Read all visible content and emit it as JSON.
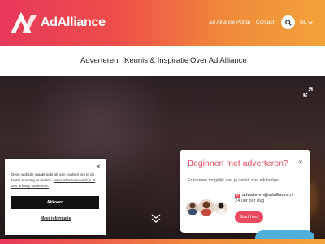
{
  "header": {
    "logo_text": "AdAlliance",
    "links": [
      "Ad Alliance Portal",
      "Contact"
    ],
    "language": "NL"
  },
  "nav": {
    "items": [
      "Adverteren",
      "Kennis & Inspiratie",
      "Over Ad Alliance"
    ]
  },
  "cookie_banner": {
    "text_intro": "Deze website maakt gebruik van cookies om je de beste ervaring te bieden.",
    "link_text": "Meer informatie vind je in ons privacy statement.",
    "accept_label": "Akkoord",
    "more_info_label": "Meer informatie"
  },
  "chat_widget": {
    "title": "Beginnen met adverteren?",
    "subtitle": "Er is meer mogelijk dan je denkt, met elk budget.",
    "email": "adverteren@adalliance.nl",
    "hours": "24 uur per dag",
    "start_label": "Start hier!"
  },
  "colors": {
    "brand_pink": "#e8385a",
    "brand_orange": "#f2a23a",
    "chat_accent": "#e84a5f"
  }
}
